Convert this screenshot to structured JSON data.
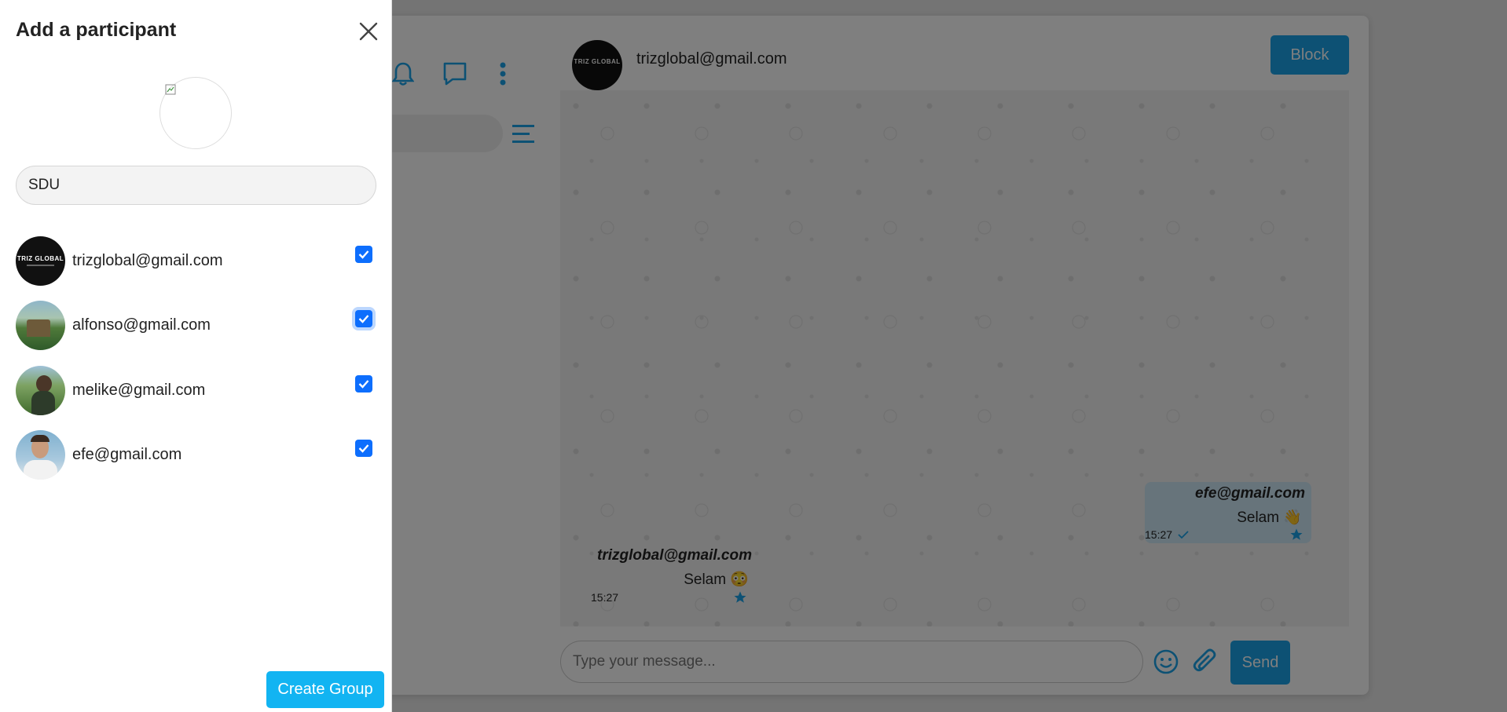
{
  "background_app": {
    "chat_header": {
      "avatar_text": "TRIZ GLOBAL",
      "contact_name": "trizglobal@gmail.com",
      "block_label": "Block"
    },
    "messages": [
      {
        "sender": "efe@gmail.com",
        "text": "Selam 👋",
        "time": "15:27",
        "direction": "outgoing",
        "read_icon": "check-icon",
        "starred": true
      },
      {
        "sender": "trizglobal@gmail.com",
        "text": "Selam 😳",
        "time": "15:27",
        "direction": "incoming",
        "starred": true
      }
    ],
    "composer": {
      "placeholder": "Type your message...",
      "send_label": "Send"
    },
    "icons": [
      "bell-icon",
      "chat-icon",
      "more-vertical-icon",
      "menu-icon",
      "emoji-icon",
      "paperclip-icon",
      "star-icon"
    ]
  },
  "panel": {
    "title": "Add a participant",
    "group_name_value": "SDU",
    "participants": [
      {
        "email": "trizglobal@gmail.com",
        "checked": true,
        "avatar": "triz-global-logo"
      },
      {
        "email": "alfonso@gmail.com",
        "checked": true,
        "avatar": "landscape-photo"
      },
      {
        "email": "melike@gmail.com",
        "checked": true,
        "avatar": "person-photo"
      },
      {
        "email": "efe@gmail.com",
        "checked": true,
        "avatar": "person-photo"
      }
    ],
    "create_label": "Create Group"
  },
  "colors": {
    "accent": "#1aa3e8",
    "checkbox": "#0d6efd",
    "create_button": "#12b4f2",
    "overlay": "rgba(0,0,0,0.5)"
  }
}
